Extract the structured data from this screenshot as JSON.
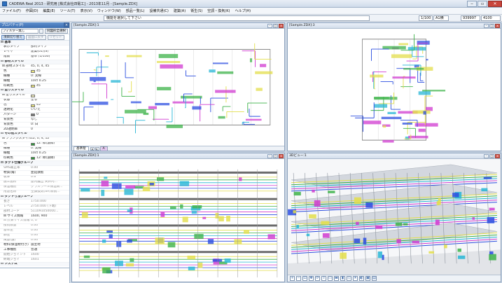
{
  "titlebar": {
    "title": "CADEWA Real 2013 - 研究用 [株式会社四電工] - 2013年11月 - [Sample.ZDX]"
  },
  "menu": [
    "ファイル(F)",
    "作図(D)",
    "編集(E)",
    "ツール(T)",
    "表示(V)",
    "ウィンドウ(W)",
    "部品一覧(L)",
    "設備共通(C)",
    "建築(A)",
    "衛生(S)",
    "空調・換気(K)",
    "ヘルプ(H)"
  ],
  "cmdbar": {
    "prompt": "機能を選択して下さい",
    "scale": "1/100",
    "paper": "A1横",
    "coord_x": "939997",
    "coord_y": "4100"
  },
  "property": {
    "title": "プロパティ(P)",
    "filter": "フィルター無し",
    "filter_btn": "同図形全選択",
    "buttons": [
      {
        "label": "項目切り替え",
        "state": "on"
      },
      {
        "label": "図面に戻す",
        "state": "off"
      },
      {
        "label": "リセット",
        "state": "off"
      }
    ],
    "rows": [
      {
        "kind": "sec",
        "k": "⊟ 基本",
        "v": ""
      },
      {
        "kind": "item",
        "k": "表示タイプ",
        "v": "部材タイプ"
      },
      {
        "kind": "item",
        "k": "レイヤ",
        "v": "建築(01)(S)"
      },
      {
        "kind": "item",
        "k": "階数",
        "v": "基準 (1/100)"
      },
      {
        "kind": "sec",
        "k": "⊟ 部材スタイル",
        "v": ""
      },
      {
        "kind": "sub",
        "k": "⊟ 部材スタイル",
        "v": "45, 0, 4, 45"
      },
      {
        "kind": "item",
        "k": "色",
        "v": "45",
        "swatch": "#e9e37a"
      },
      {
        "kind": "item",
        "k": "線種",
        "v": "0: 実線"
      },
      {
        "kind": "item",
        "k": "線幅",
        "v": "10ct  0.25"
      },
      {
        "kind": "item",
        "k": "印刷色",
        "v": "45",
        "swatch": "#e9e37a"
      },
      {
        "kind": "sec",
        "k": "⊟ 塗りスタイル",
        "v": ""
      },
      {
        "kind": "sub",
        "k": "⊟ 塗りスタイル",
        "v": "",
        "swatch": "#eae7b8"
      },
      {
        "kind": "item",
        "k": "状態",
        "v": "塗る"
      },
      {
        "kind": "item",
        "k": "色",
        "v": "45",
        "swatch": "#e9e37a"
      },
      {
        "kind": "item",
        "k": "透明化",
        "v": "いいえ"
      },
      {
        "kind": "item",
        "k": "パターン",
        "v": "0",
        "swatch": "#777777"
      },
      {
        "kind": "item",
        "k": "背景色",
        "v": "なし"
      },
      {
        "kind": "item",
        "k": "背景色",
        "v": "0: 白"
      },
      {
        "kind": "item",
        "k": "2D透明率",
        "v": "0"
      },
      {
        "kind": "sec",
        "k": "⊟ その他スタイル",
        "v": ""
      },
      {
        "kind": "sub",
        "k": "⊟ フランジスタイル",
        "v": "12, 0, 4, 12"
      },
      {
        "kind": "item",
        "k": "色",
        "v": "12: 緑(濃緑)",
        "swatch": "#2f9a3a"
      },
      {
        "kind": "item",
        "k": "線種",
        "v": "0: 実線"
      },
      {
        "kind": "item",
        "k": "線幅",
        "v": "10ct  0.25"
      },
      {
        "kind": "item",
        "k": "印刷色",
        "v": "12: 緑(濃緑)",
        "swatch": "#2f9a3a"
      },
      {
        "kind": "sec",
        "k": "⊟ ダクト仕様グループ",
        "v": ""
      },
      {
        "kind": "gray",
        "k": "SMS補正率",
        "v": "0.00"
      },
      {
        "kind": "item",
        "k": "材質(角)",
        "v": "亜鉛鉄板"
      },
      {
        "kind": "gray",
        "k": "板厚",
        "v": "0.6"
      },
      {
        "kind": "gray",
        "k": "施工箇所",
        "v": "屋内露出 天井内..."
      },
      {
        "kind": "gray",
        "k": "保温種別",
        "v": "グラスウール保温筒..."
      },
      {
        "kind": "gray",
        "k": "用途名称",
        "v": "空調換気(SA)系統..."
      },
      {
        "kind": "sec",
        "k": "⊟ ダクト寸法グループ",
        "v": ""
      },
      {
        "kind": "gray",
        "k": "長さ",
        "v": "1750.000"
      },
      {
        "kind": "gray",
        "k": "レベル",
        "v": "2750.000 (下端)"
      },
      {
        "kind": "gray",
        "k": "部材コード",
        "v": "511091050000..."
      },
      {
        "kind": "item",
        "k": "⊟ サイズ情報",
        "v": "1600, 900"
      },
      {
        "kind": "gray",
        "k": "⊟ 計算サイズ情報",
        "v": "0, 0"
      },
      {
        "kind": "gray",
        "k": "接続数量",
        "v": "0.00"
      },
      {
        "kind": "gray",
        "k": "基準圧",
        "v": "0.00"
      },
      {
        "kind": "gray",
        "k": "静圧",
        "v": "0.00"
      },
      {
        "kind": "gray",
        "k": "風量(設)",
        "v": "0.00"
      },
      {
        "kind": "item",
        "k": "材料(保温材付き)",
        "v": "施主材"
      },
      {
        "kind": "item",
        "k": "工事種別",
        "v": "普通"
      },
      {
        "kind": "gray",
        "k": "開始ジョイント",
        "v": "1600"
      },
      {
        "kind": "gray",
        "k": "終端ジョイ",
        "v": "1601"
      },
      {
        "kind": "sec",
        "k": "⊟ システム",
        "v": ""
      },
      {
        "kind": "gray",
        "k": "系 設置値",
        "v": "17900.000, 99..."
      }
    ]
  },
  "views": [
    {
      "title": "[Sample.ZDX]:1",
      "sheet_tabs": [
        "基準階",
        "A"
      ]
    },
    {
      "title": "[Sample.ZDX]:3"
    },
    {
      "title": "[Sample.ZDX]:1"
    },
    {
      "title": "3Dビュー:1"
    }
  ],
  "toolbar3d": [
    "zoom-in",
    "zoom-out",
    "fit",
    "pan",
    "rotate",
    "walk",
    "front-view",
    "top-view",
    "side-view",
    "iso-view",
    "light",
    "render",
    "capture",
    "save"
  ],
  "colors": {
    "duct_yellow": "#e3de4b",
    "duct_green": "#3db34a",
    "pipe_cyan": "#27b6d6",
    "pipe_magenta": "#d03ad0",
    "pipe_blue": "#2b4ee0",
    "wall_gray": "#6b6b6b"
  }
}
